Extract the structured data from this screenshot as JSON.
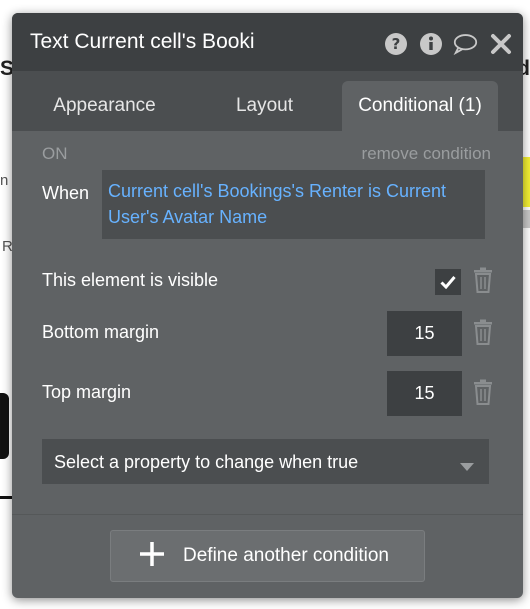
{
  "background": {
    "left_fragment_1": "Si",
    "left_fragment_2": "n",
    "left_fragment_3": "R",
    "right_fragment_1": "d"
  },
  "panel": {
    "title": "Text Current cell's Booki",
    "header_icons": [
      "help-icon",
      "info-icon",
      "comment-icon",
      "close-icon"
    ]
  },
  "tabs": [
    {
      "label": "Appearance",
      "active": false
    },
    {
      "label": "Layout",
      "active": false
    },
    {
      "label": "Conditional (1)",
      "active": true
    }
  ],
  "condition": {
    "status": "ON",
    "remove_label": "remove condition",
    "when_label": "When",
    "expression": "Current cell's Bookings's Renter is Current User's Avatar Name"
  },
  "properties": [
    {
      "label": "This element is visible",
      "type": "checkbox",
      "checked": true
    },
    {
      "label": "Bottom margin",
      "type": "number",
      "value": "15"
    },
    {
      "label": "Top margin",
      "type": "number",
      "value": "15"
    }
  ],
  "property_select": {
    "placeholder": "Select a property to change when true"
  },
  "define_button": {
    "label": "Define another condition"
  },
  "colors": {
    "panel_bg": "#5f6264",
    "header_bg": "#3d4042",
    "expression_text": "#67b2ff"
  }
}
